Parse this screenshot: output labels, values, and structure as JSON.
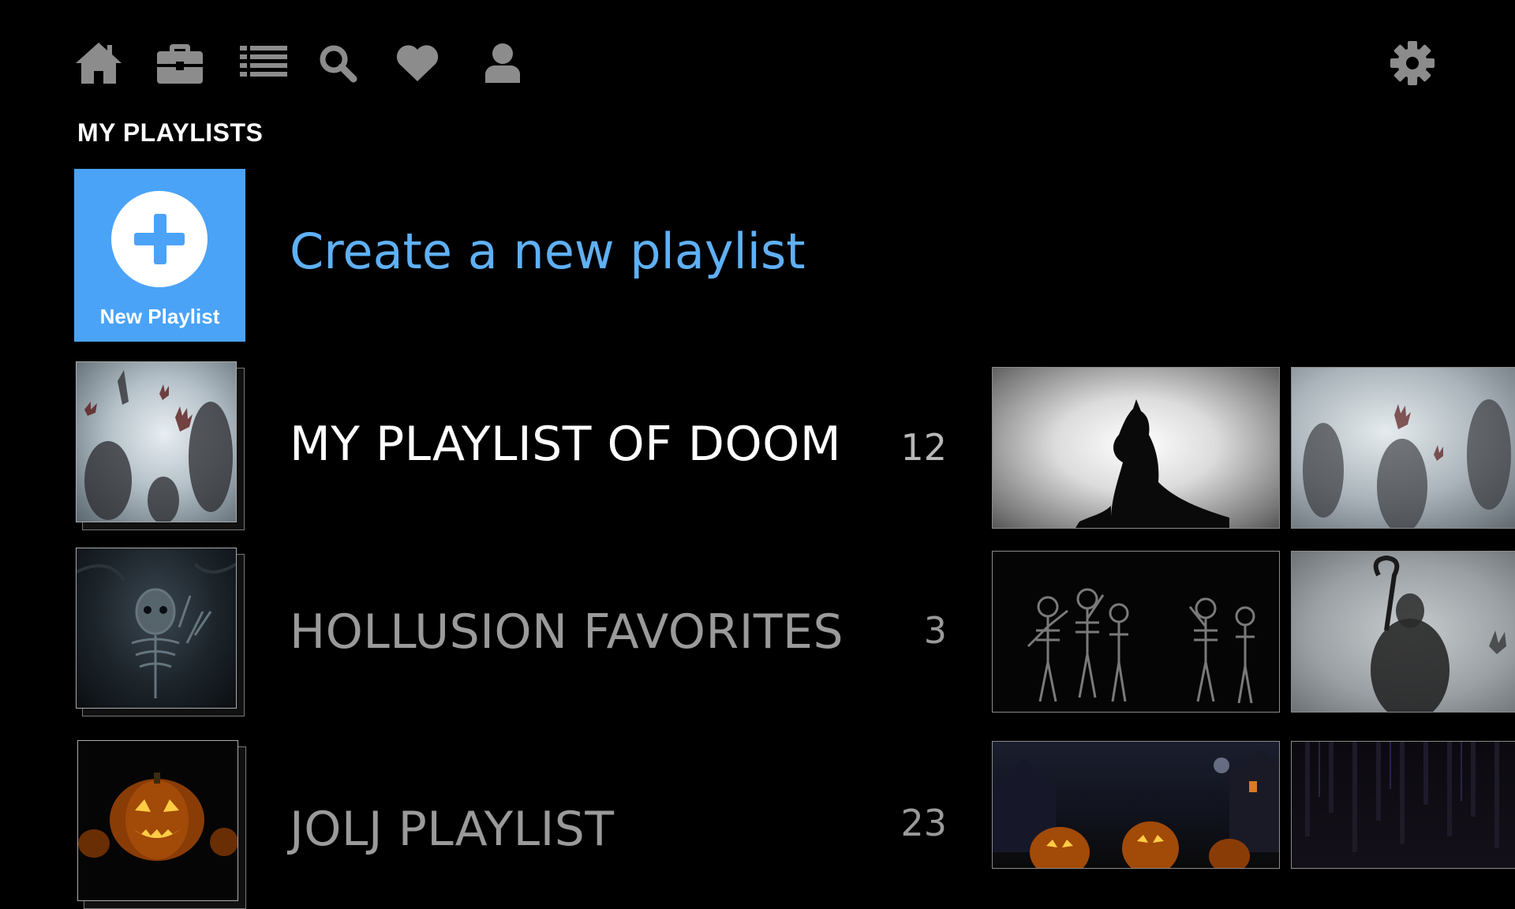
{
  "nav": {
    "icons": [
      "home-icon",
      "briefcase-icon",
      "list-icon",
      "search-icon",
      "heart-icon",
      "user-icon"
    ],
    "settings_icon": "gear-icon"
  },
  "section_title": "MY PLAYLISTS",
  "new_playlist": {
    "tile_label": "New Playlist",
    "create_text": "Create a new playlist"
  },
  "playlists": [
    {
      "name": "MY PLAYLIST OF DOOM",
      "count": "12"
    },
    {
      "name": "HOLLUSION FAVORITES",
      "count": "3"
    },
    {
      "name": "JOLJ PLAYLIST",
      "count": "23"
    }
  ],
  "colors": {
    "accent": "#4aa3f7",
    "link": "#5fb0f5",
    "icon": "#8c8c8c",
    "selected_text": "#ffffff",
    "dim_text": "#9a9a9a"
  }
}
